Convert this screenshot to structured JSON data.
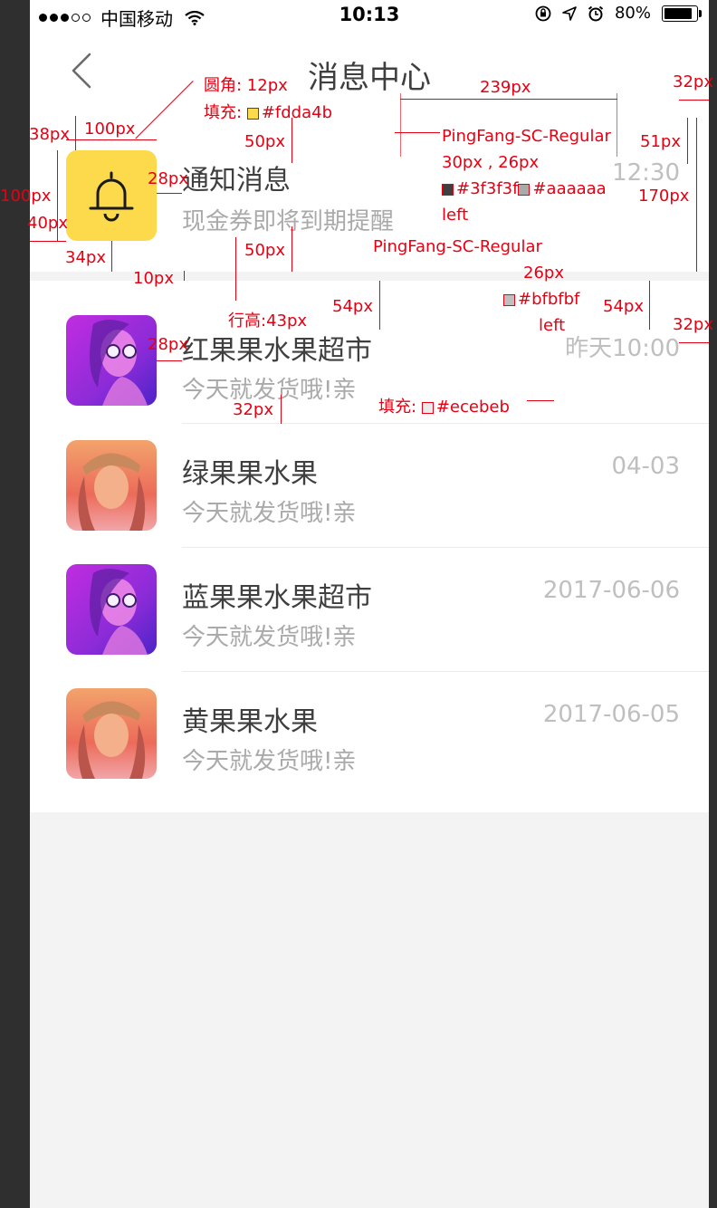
{
  "status_bar": {
    "carrier": "中国移动",
    "time": "10:13",
    "battery": "80%"
  },
  "nav": {
    "title": "消息中心"
  },
  "notice": {
    "title": "通知消息",
    "subtitle": "现金券即将到期提醒",
    "time": "12:30"
  },
  "messages": [
    {
      "name": "红果果水果超市",
      "preview": "今天就发货哦!亲",
      "time": "昨天10:00",
      "avatar_tint": "purple"
    },
    {
      "name": "绿果果水果",
      "preview": "今天就发货哦!亲",
      "time": "04-03",
      "avatar_tint": "orange"
    },
    {
      "name": "蓝果果水果超市",
      "preview": "今天就发货哦!亲",
      "time": "2017-06-06",
      "avatar_tint": "purple"
    },
    {
      "name": "黄果果水果",
      "preview": "今天就发货哦!亲",
      "time": "2017-06-05",
      "avatar_tint": "orange"
    }
  ],
  "annotations": {
    "radius": "圆角: 12px",
    "fill": "填充:",
    "fill_color": "#fdda4b",
    "w239": "239px",
    "w32a": "32px",
    "h38": "38px",
    "w100": "100px",
    "h50a": "50px",
    "font1": "PingFang-SC-Regular",
    "font1_size": "30px , 26px",
    "color1": "#3f3f3f",
    "color2": "#aaaaaa",
    "align1": "left",
    "h51": "51px",
    "h170": "170px",
    "w28a": "28px",
    "h100": "100px",
    "w40": "40px",
    "h50b": "50px",
    "font2": "PingFang-SC-Regular",
    "font2_size": "26px",
    "color3": "#bfbfbf",
    "align2": "left",
    "h34": "34px",
    "h10": "10px",
    "lineheight": "行高:43px",
    "h54a": "54px",
    "h54b": "54px",
    "w32b": "32px",
    "w28b": "28px",
    "h32": "32px",
    "sep_fill": "填充:",
    "sep_color": "#ecebeb"
  }
}
